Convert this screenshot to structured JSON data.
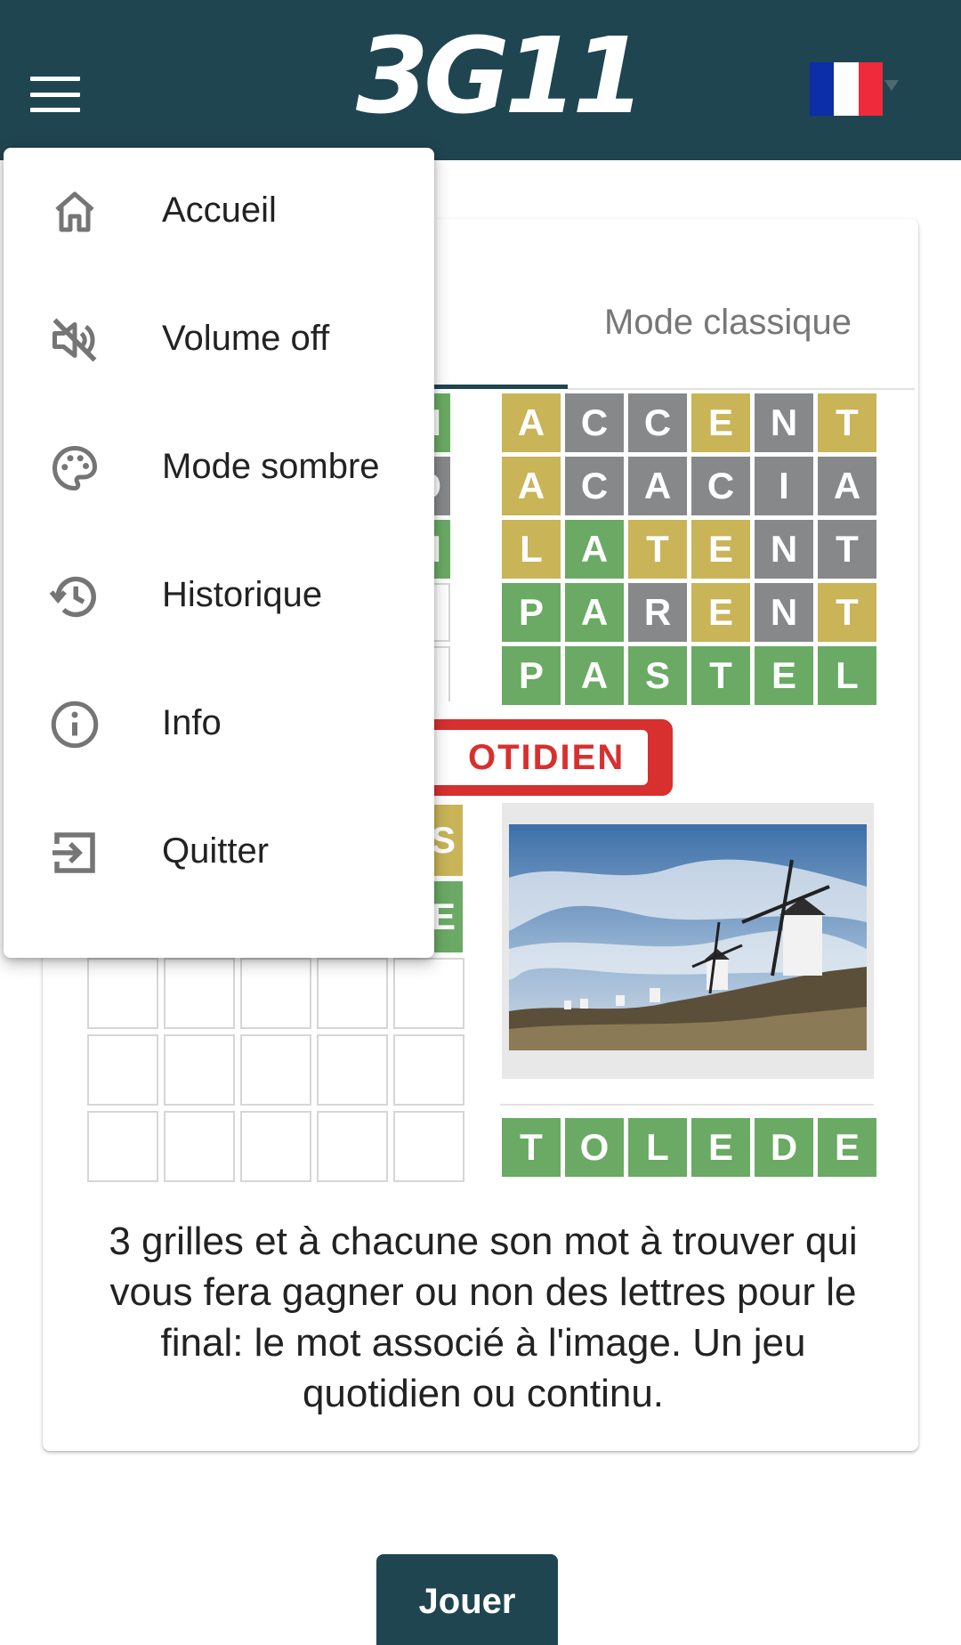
{
  "header": {
    "logo_text": "3G11",
    "language_flag": "fr-flag-icon"
  },
  "menu": {
    "items": [
      {
        "label": "Accueil",
        "icon": "home-icon"
      },
      {
        "label": "Volume off",
        "icon": "volume-off-icon"
      },
      {
        "label": "Mode sombre",
        "icon": "palette-icon"
      },
      {
        "label": "Historique",
        "icon": "history-icon"
      },
      {
        "label": "Info",
        "icon": "info-icon"
      },
      {
        "label": "Quitter",
        "icon": "exit-icon"
      }
    ]
  },
  "card": {
    "tab_label": "Mode classique",
    "ribbon_text": "OTIDIEN",
    "grid": [
      [
        {
          "l": "A",
          "s": "y"
        },
        {
          "l": "C",
          "s": "x"
        },
        {
          "l": "C",
          "s": "x"
        },
        {
          "l": "E",
          "s": "y"
        },
        {
          "l": "N",
          "s": "x"
        },
        {
          "l": "T",
          "s": "y"
        }
      ],
      [
        {
          "l": "A",
          "s": "y"
        },
        {
          "l": "C",
          "s": "x"
        },
        {
          "l": "A",
          "s": "x"
        },
        {
          "l": "C",
          "s": "x"
        },
        {
          "l": "I",
          "s": "x"
        },
        {
          "l": "A",
          "s": "x"
        }
      ],
      [
        {
          "l": "L",
          "s": "y"
        },
        {
          "l": "A",
          "s": "g"
        },
        {
          "l": "T",
          "s": "y"
        },
        {
          "l": "E",
          "s": "y"
        },
        {
          "l": "N",
          "s": "x"
        },
        {
          "l": "T",
          "s": "x"
        }
      ],
      [
        {
          "l": "P",
          "s": "g"
        },
        {
          "l": "A",
          "s": "g"
        },
        {
          "l": "R",
          "s": "x"
        },
        {
          "l": "E",
          "s": "y"
        },
        {
          "l": "N",
          "s": "x"
        },
        {
          "l": "T",
          "s": "y"
        }
      ],
      [
        {
          "l": "P",
          "s": "g"
        },
        {
          "l": "A",
          "s": "g"
        },
        {
          "l": "S",
          "s": "g"
        },
        {
          "l": "T",
          "s": "g"
        },
        {
          "l": "E",
          "s": "g"
        },
        {
          "l": "L",
          "s": "g"
        }
      ]
    ],
    "final_word": [
      "T",
      "O",
      "L",
      "E",
      "D",
      "E"
    ],
    "partial_top_letters": [
      "N",
      "O",
      "N"
    ],
    "partial_lower_letters": [
      "S",
      "E"
    ],
    "description": "3 grilles et à chacune son mot à trouver qui vous fera gagner ou non des lettres pour le final: le mot associé à l'image. Un jeu quotidien ou continu."
  },
  "play_button": "Jouer",
  "colors": {
    "header_bg": "#1f4550",
    "tile_yellow": "#c9b458",
    "tile_green": "#6aaa64",
    "tile_gray": "#86888a",
    "ribbon_red": "#d7302f"
  }
}
